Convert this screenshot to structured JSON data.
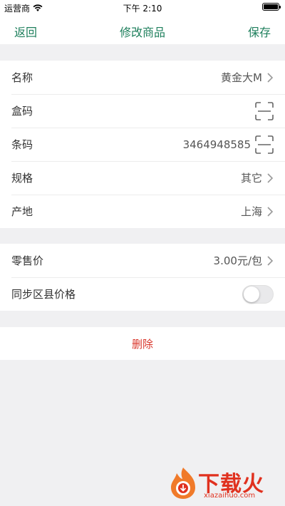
{
  "status_bar": {
    "carrier": "运营商",
    "time": "下午 2:10",
    "battery_level": 1.0
  },
  "nav": {
    "back_label": "返回",
    "title": "修改商品",
    "save_label": "保存"
  },
  "group1": [
    {
      "label": "名称",
      "value": "黄金大M",
      "accessory": "chevron-icon"
    },
    {
      "label": "盒码",
      "value": "",
      "accessory": "scan-icon"
    },
    {
      "label": "条码",
      "value": "3464948585",
      "accessory": "scan-icon"
    },
    {
      "label": "规格",
      "value": "其它",
      "accessory": "chevron-icon"
    },
    {
      "label": "产地",
      "value": "上海",
      "accessory": "chevron-icon"
    }
  ],
  "group2": [
    {
      "label": "零售价",
      "value": "3.00元/包",
      "accessory": "chevron-icon"
    },
    {
      "label": "同步区县价格",
      "toggle_on": false
    }
  ],
  "delete_label": "删除",
  "colors": {
    "accent": "#1e7f5c",
    "danger": "#d9362b",
    "background": "#f0f0f2"
  },
  "watermark": {
    "brand": "下载火",
    "url": "xiazaihuo.com"
  }
}
